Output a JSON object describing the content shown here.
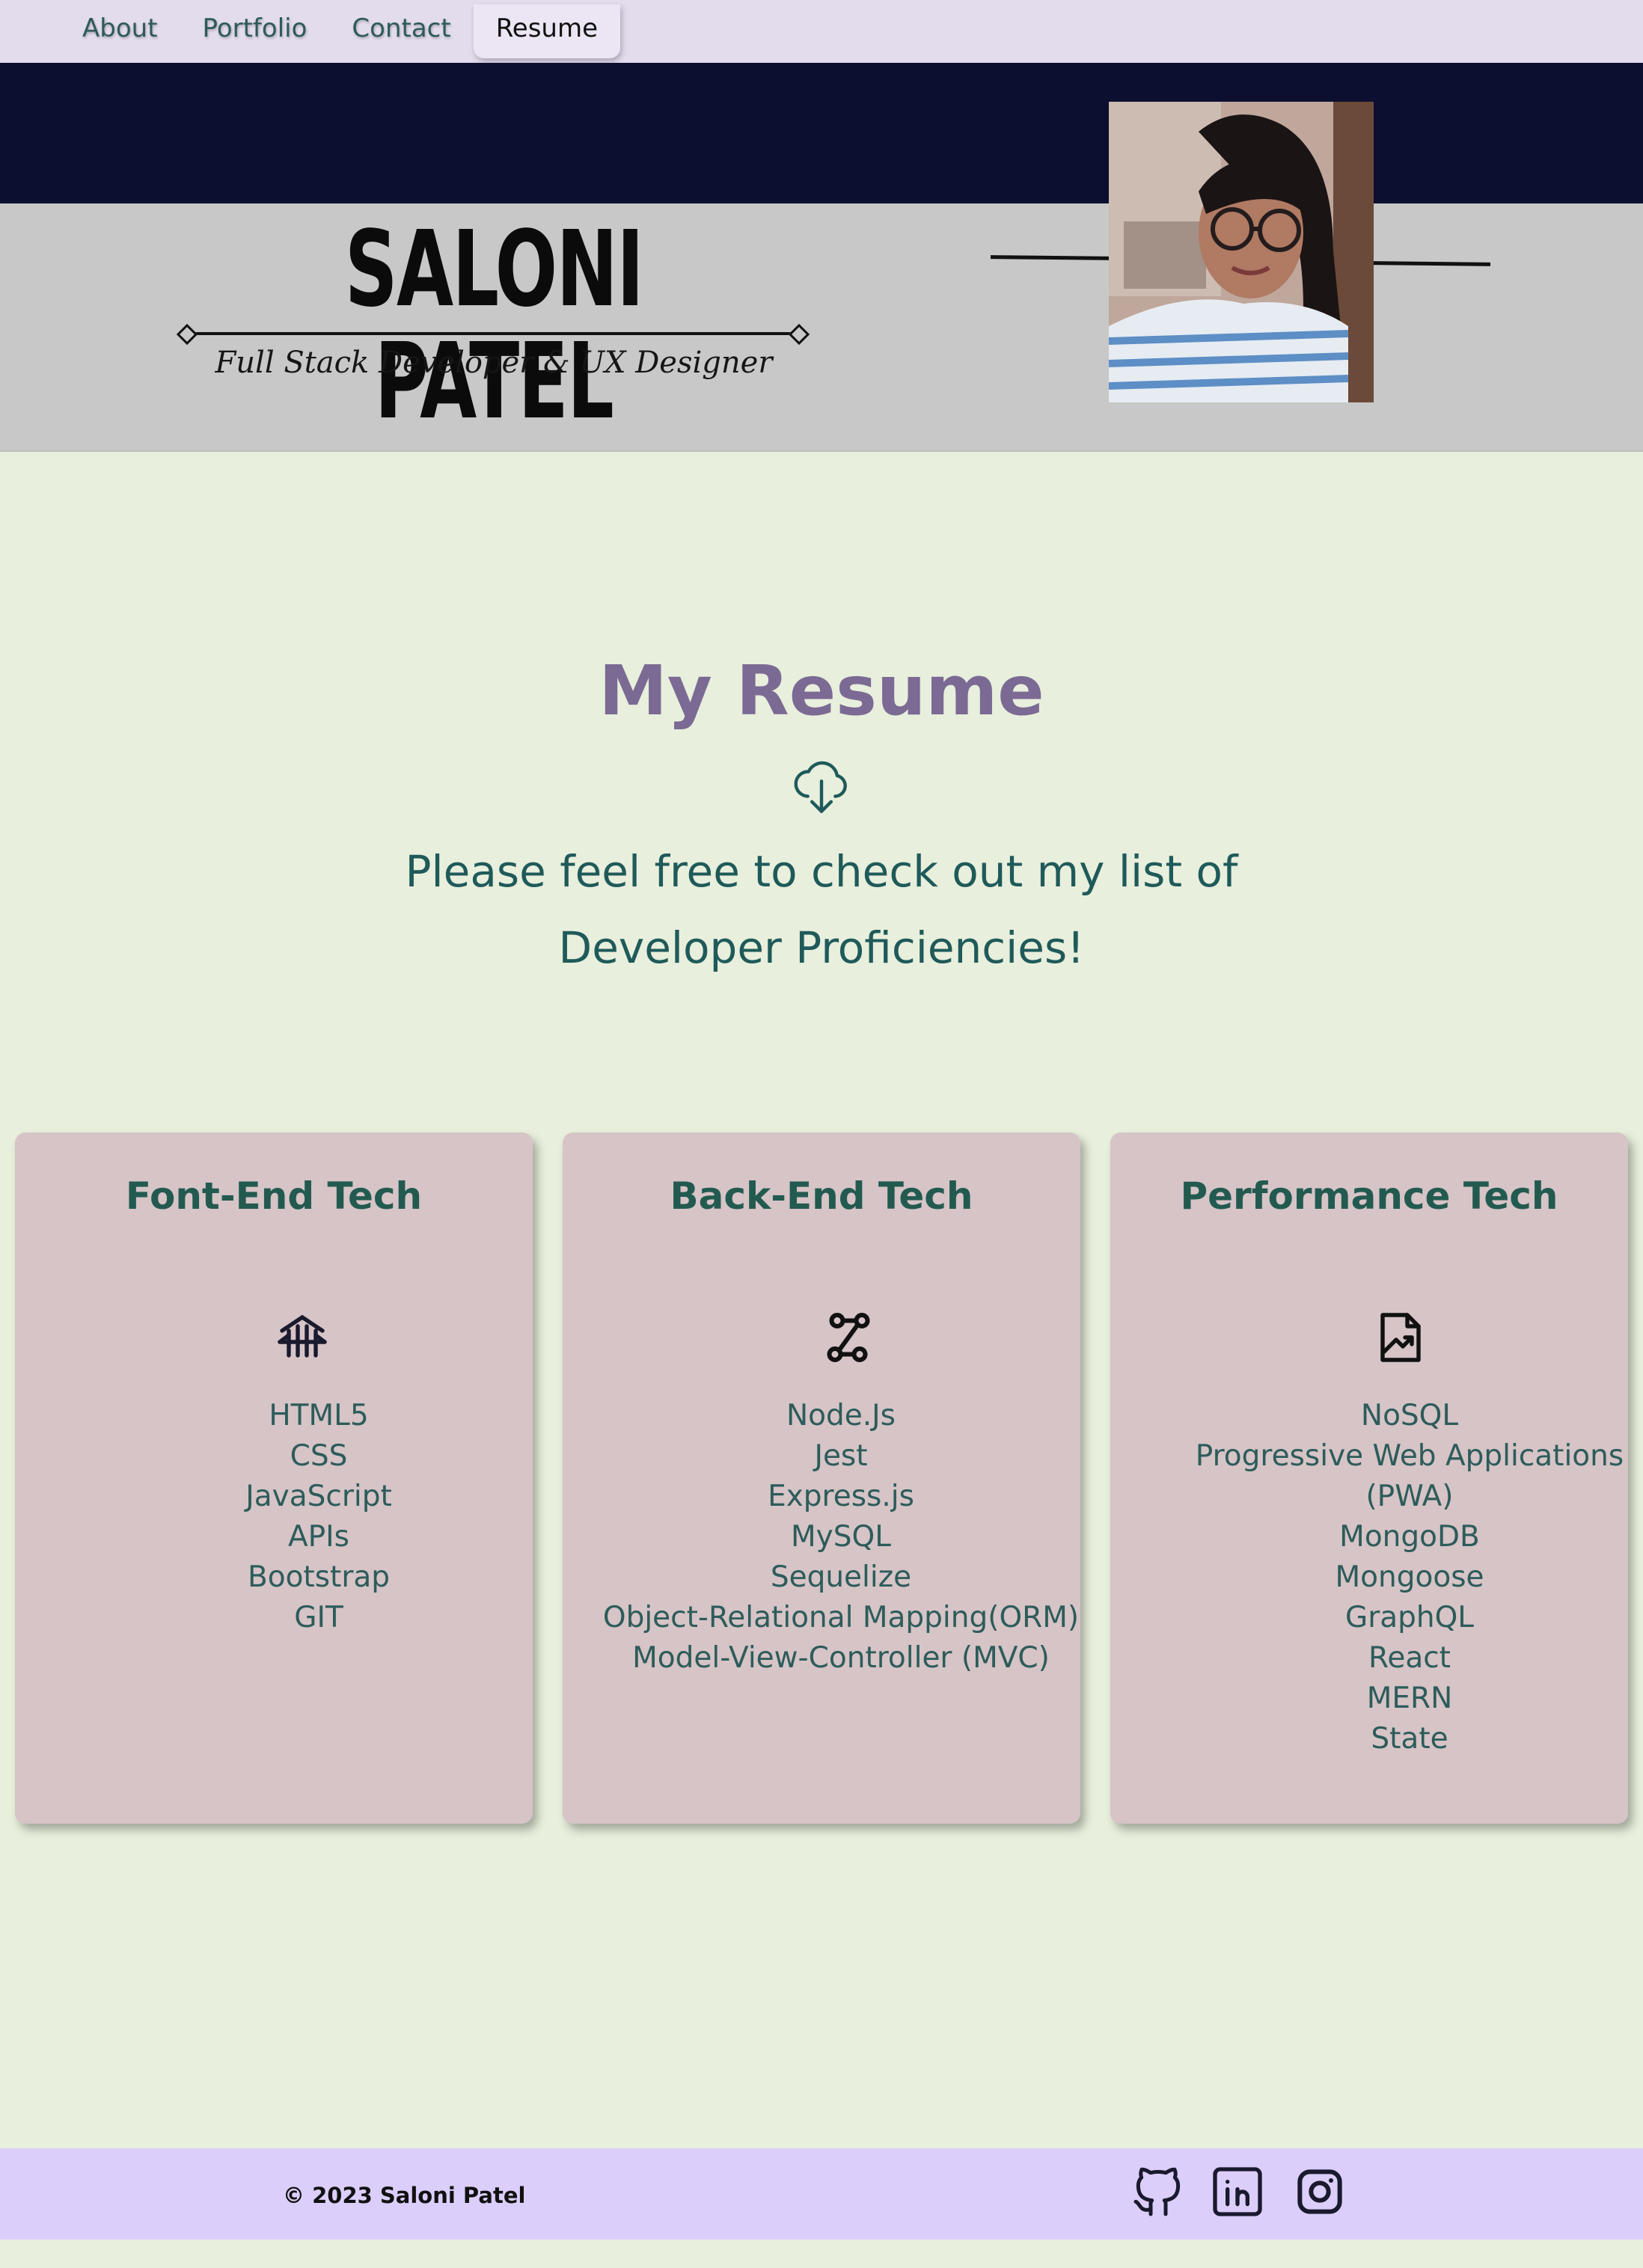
{
  "nav": {
    "items": [
      {
        "label": "About"
      },
      {
        "label": "Portfolio"
      },
      {
        "label": "Contact"
      },
      {
        "label": "Resume"
      }
    ],
    "active": "Resume"
  },
  "header": {
    "name": "SALONI PATEL",
    "subtitle": "Full Stack Developer & UX Designer",
    "photo": "profile-photo"
  },
  "main": {
    "title": "My Resume",
    "icon": "cloud-download-icon",
    "intro": "Please feel free to check out my list of Developer Proficiencies!"
  },
  "cards": [
    {
      "title": "Font-End Tech",
      "icon": "bridge-icon",
      "items": [
        "HTML5",
        "CSS",
        "JavaScript",
        "APIs",
        "Bootstrap",
        "GIT"
      ]
    },
    {
      "title": "Back-End Tech",
      "icon": "route-icon",
      "items": [
        "Node.Js",
        "Jest",
        "Express.js",
        "MySQL",
        "Sequelize",
        "Object-Relational Mapping(ORM)",
        "Model-View-Controller (MVC)"
      ]
    },
    {
      "title": "Performance Tech",
      "icon": "file-chart-icon",
      "items": [
        "NoSQL",
        "Progressive Web Applications (PWA)",
        "MongoDB",
        "Mongoose",
        "GraphQL",
        "React",
        "MERN",
        "State"
      ]
    }
  ],
  "footer": {
    "copyright": "© 2023 Saloni Patel",
    "social": [
      "github-icon",
      "linkedin-icon",
      "instagram-icon"
    ]
  },
  "colors": {
    "nav_bg": "#e3dced",
    "header_dark": "#0c0f2f",
    "header_gray": "#c8c8c8",
    "page_bg": "#e8efdc",
    "title_purple": "#7b6a94",
    "teal_text": "#1f5a5a",
    "card_bg": "#d6c4c7",
    "footer_bg": "#dccefa"
  }
}
